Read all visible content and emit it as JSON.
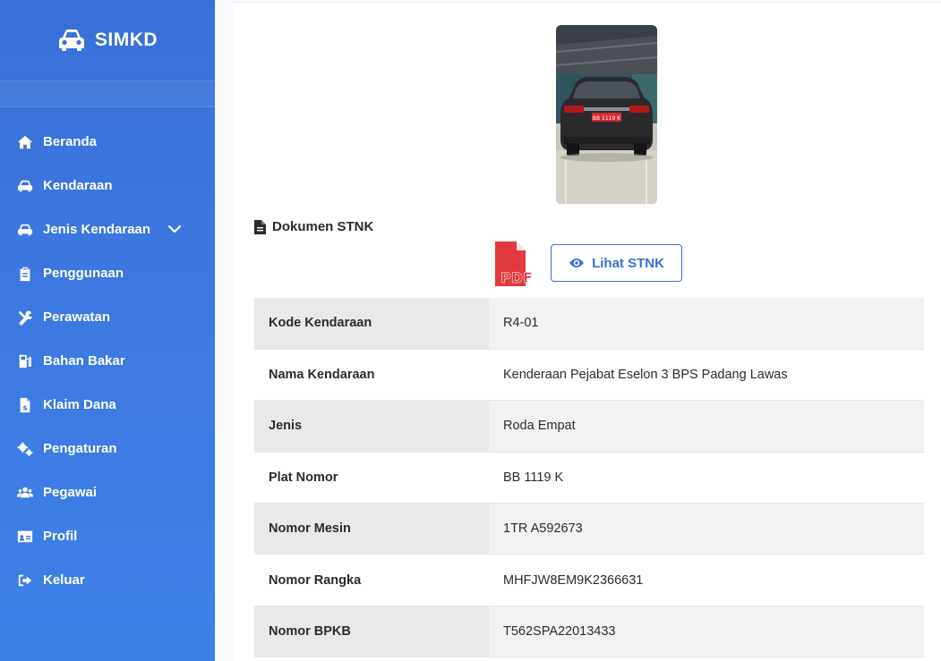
{
  "brand": {
    "name": "SIMKD",
    "icon": "car-icon"
  },
  "sidebar": {
    "items": [
      {
        "label": "Beranda",
        "icon": "home-icon"
      },
      {
        "label": "Kendaraan",
        "icon": "car-icon"
      },
      {
        "label": "Jenis Kendaraan",
        "icon": "car-icon",
        "has_submenu": true
      },
      {
        "label": "Penggunaan",
        "icon": "clipboard-icon"
      },
      {
        "label": "Perawatan",
        "icon": "tools-icon"
      },
      {
        "label": "Bahan Bakar",
        "icon": "gas-pump-icon"
      },
      {
        "label": "Klaim Dana",
        "icon": "file-invoice-dollar-icon"
      },
      {
        "label": "Pengaturan",
        "icon": "gears-icon"
      },
      {
        "label": "Pegawai",
        "icon": "users-icon"
      },
      {
        "label": "Profil",
        "icon": "id-card-icon"
      },
      {
        "label": "Keluar",
        "icon": "sign-out-icon"
      }
    ]
  },
  "detail": {
    "document_section_title": "Dokumen STNK",
    "view_button_label": "Lihat STNK",
    "pdf_icon_text": "PDF",
    "plate_on_photo": "BB 1119 K",
    "rows": [
      {
        "label": "Kode Kendaraan",
        "value": "R4-01"
      },
      {
        "label": "Nama Kendaraan",
        "value": "Kenderaan Pejabat Eselon 3 BPS Padang Lawas"
      },
      {
        "label": "Jenis",
        "value": "Roda Empat"
      },
      {
        "label": "Plat Nomor",
        "value": "BB 1119 K"
      },
      {
        "label": "Nomor Mesin",
        "value": "1TR A592673"
      },
      {
        "label": "Nomor Rangka",
        "value": "MHFJW8EM9K2366631"
      },
      {
        "label": "Nomor BPKB",
        "value": "T562SPA22013433"
      }
    ]
  },
  "colors": {
    "sidebar": "#3a6fd8",
    "accent": "#3a6fd8",
    "pdf_red": "#e03a3e"
  }
}
